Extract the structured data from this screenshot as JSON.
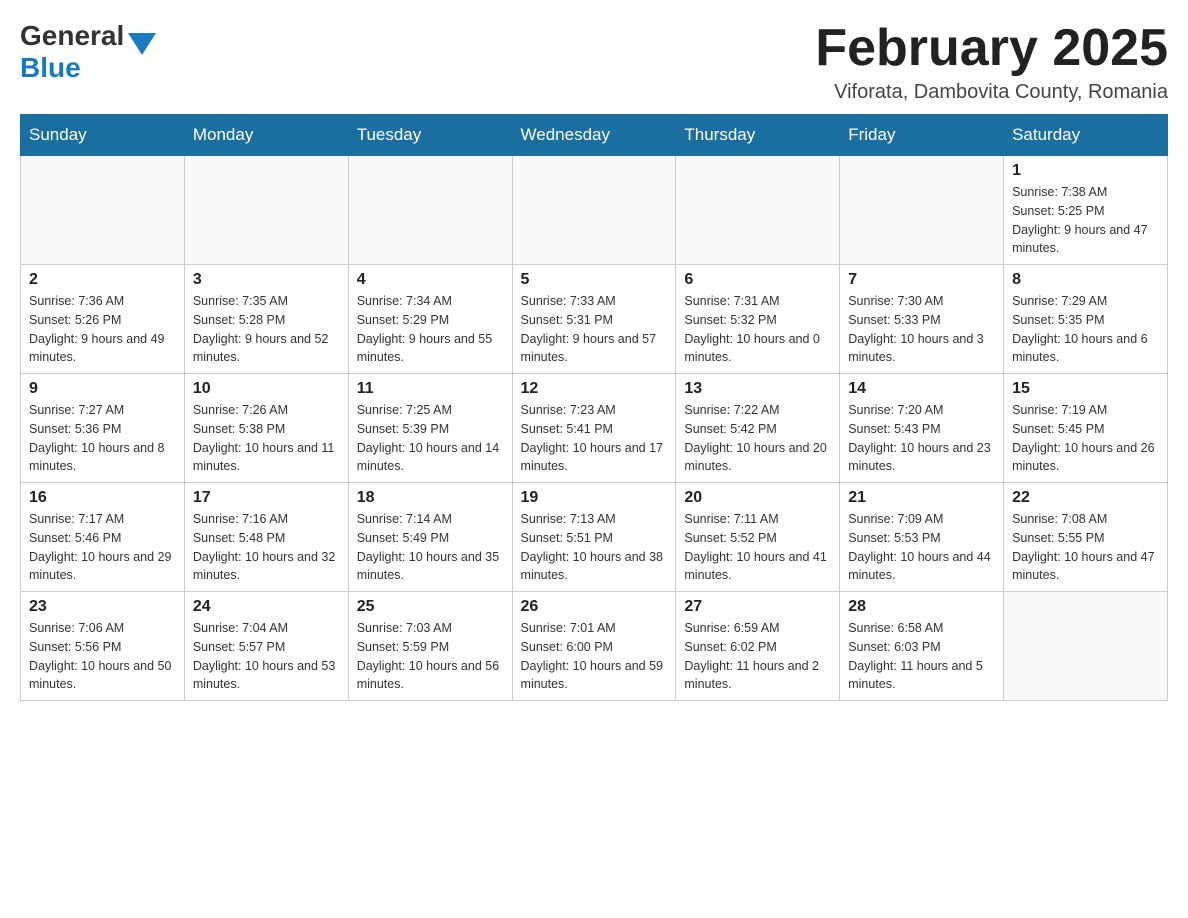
{
  "header": {
    "logo_general": "General",
    "logo_blue": "Blue",
    "month_title": "February 2025",
    "location": "Viforata, Dambovita County, Romania"
  },
  "weekdays": [
    "Sunday",
    "Monday",
    "Tuesday",
    "Wednesday",
    "Thursday",
    "Friday",
    "Saturday"
  ],
  "weeks": [
    [
      {
        "day": "",
        "info": ""
      },
      {
        "day": "",
        "info": ""
      },
      {
        "day": "",
        "info": ""
      },
      {
        "day": "",
        "info": ""
      },
      {
        "day": "",
        "info": ""
      },
      {
        "day": "",
        "info": ""
      },
      {
        "day": "1",
        "info": "Sunrise: 7:38 AM\nSunset: 5:25 PM\nDaylight: 9 hours and 47 minutes."
      }
    ],
    [
      {
        "day": "2",
        "info": "Sunrise: 7:36 AM\nSunset: 5:26 PM\nDaylight: 9 hours and 49 minutes."
      },
      {
        "day": "3",
        "info": "Sunrise: 7:35 AM\nSunset: 5:28 PM\nDaylight: 9 hours and 52 minutes."
      },
      {
        "day": "4",
        "info": "Sunrise: 7:34 AM\nSunset: 5:29 PM\nDaylight: 9 hours and 55 minutes."
      },
      {
        "day": "5",
        "info": "Sunrise: 7:33 AM\nSunset: 5:31 PM\nDaylight: 9 hours and 57 minutes."
      },
      {
        "day": "6",
        "info": "Sunrise: 7:31 AM\nSunset: 5:32 PM\nDaylight: 10 hours and 0 minutes."
      },
      {
        "day": "7",
        "info": "Sunrise: 7:30 AM\nSunset: 5:33 PM\nDaylight: 10 hours and 3 minutes."
      },
      {
        "day": "8",
        "info": "Sunrise: 7:29 AM\nSunset: 5:35 PM\nDaylight: 10 hours and 6 minutes."
      }
    ],
    [
      {
        "day": "9",
        "info": "Sunrise: 7:27 AM\nSunset: 5:36 PM\nDaylight: 10 hours and 8 minutes."
      },
      {
        "day": "10",
        "info": "Sunrise: 7:26 AM\nSunset: 5:38 PM\nDaylight: 10 hours and 11 minutes."
      },
      {
        "day": "11",
        "info": "Sunrise: 7:25 AM\nSunset: 5:39 PM\nDaylight: 10 hours and 14 minutes."
      },
      {
        "day": "12",
        "info": "Sunrise: 7:23 AM\nSunset: 5:41 PM\nDaylight: 10 hours and 17 minutes."
      },
      {
        "day": "13",
        "info": "Sunrise: 7:22 AM\nSunset: 5:42 PM\nDaylight: 10 hours and 20 minutes."
      },
      {
        "day": "14",
        "info": "Sunrise: 7:20 AM\nSunset: 5:43 PM\nDaylight: 10 hours and 23 minutes."
      },
      {
        "day": "15",
        "info": "Sunrise: 7:19 AM\nSunset: 5:45 PM\nDaylight: 10 hours and 26 minutes."
      }
    ],
    [
      {
        "day": "16",
        "info": "Sunrise: 7:17 AM\nSunset: 5:46 PM\nDaylight: 10 hours and 29 minutes."
      },
      {
        "day": "17",
        "info": "Sunrise: 7:16 AM\nSunset: 5:48 PM\nDaylight: 10 hours and 32 minutes."
      },
      {
        "day": "18",
        "info": "Sunrise: 7:14 AM\nSunset: 5:49 PM\nDaylight: 10 hours and 35 minutes."
      },
      {
        "day": "19",
        "info": "Sunrise: 7:13 AM\nSunset: 5:51 PM\nDaylight: 10 hours and 38 minutes."
      },
      {
        "day": "20",
        "info": "Sunrise: 7:11 AM\nSunset: 5:52 PM\nDaylight: 10 hours and 41 minutes."
      },
      {
        "day": "21",
        "info": "Sunrise: 7:09 AM\nSunset: 5:53 PM\nDaylight: 10 hours and 44 minutes."
      },
      {
        "day": "22",
        "info": "Sunrise: 7:08 AM\nSunset: 5:55 PM\nDaylight: 10 hours and 47 minutes."
      }
    ],
    [
      {
        "day": "23",
        "info": "Sunrise: 7:06 AM\nSunset: 5:56 PM\nDaylight: 10 hours and 50 minutes."
      },
      {
        "day": "24",
        "info": "Sunrise: 7:04 AM\nSunset: 5:57 PM\nDaylight: 10 hours and 53 minutes."
      },
      {
        "day": "25",
        "info": "Sunrise: 7:03 AM\nSunset: 5:59 PM\nDaylight: 10 hours and 56 minutes."
      },
      {
        "day": "26",
        "info": "Sunrise: 7:01 AM\nSunset: 6:00 PM\nDaylight: 10 hours and 59 minutes."
      },
      {
        "day": "27",
        "info": "Sunrise: 6:59 AM\nSunset: 6:02 PM\nDaylight: 11 hours and 2 minutes."
      },
      {
        "day": "28",
        "info": "Sunrise: 6:58 AM\nSunset: 6:03 PM\nDaylight: 11 hours and 5 minutes."
      },
      {
        "day": "",
        "info": ""
      }
    ]
  ]
}
